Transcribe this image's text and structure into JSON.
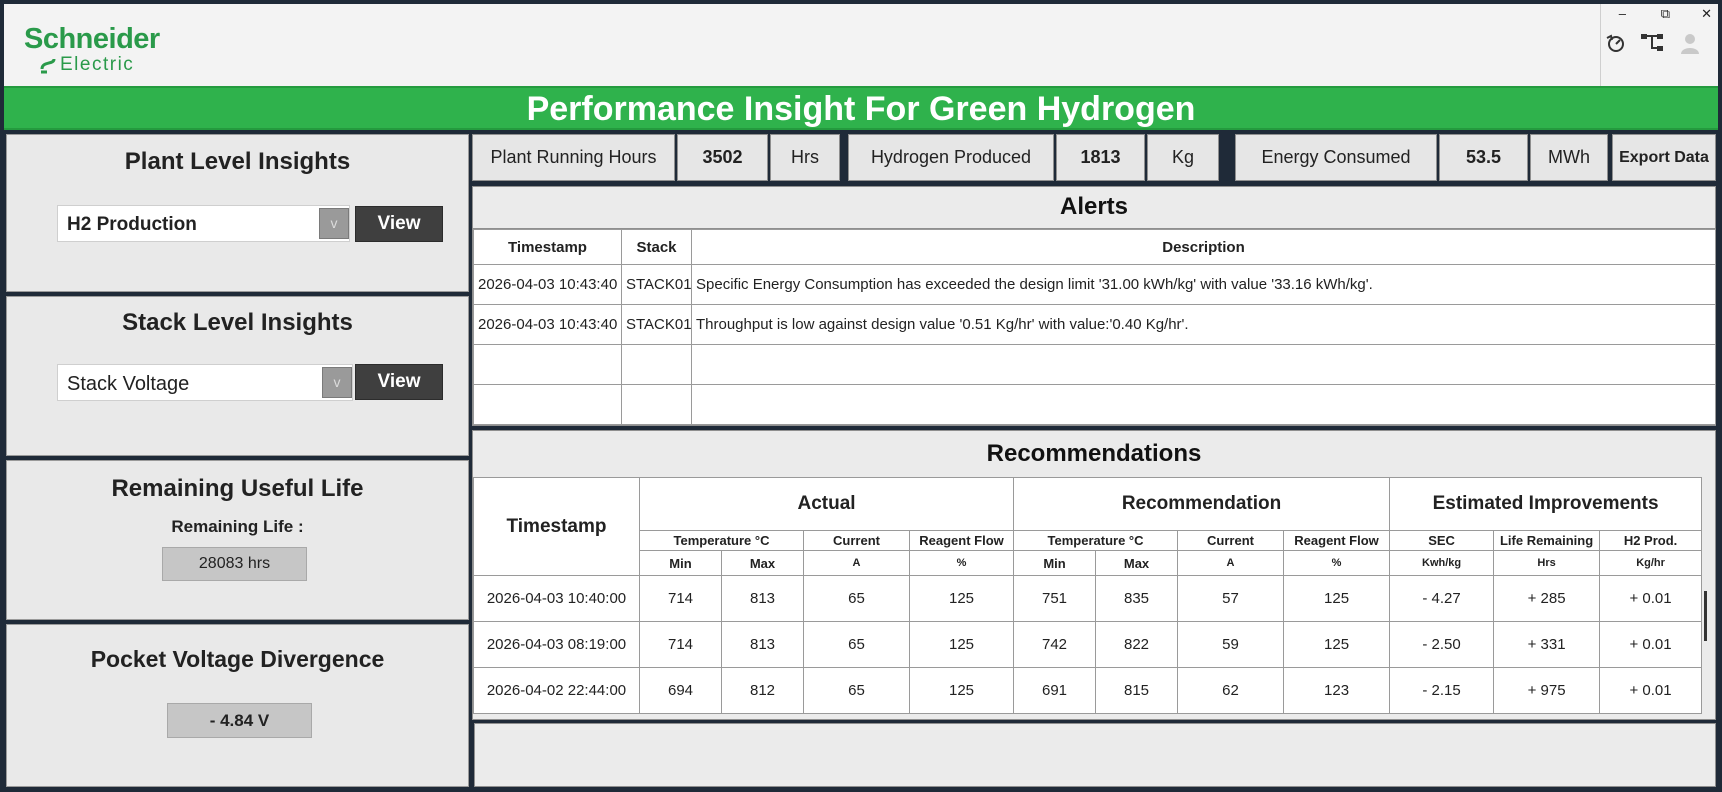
{
  "window": {
    "logo_line1": "Schneider",
    "logo_line2": "Electric",
    "controls": {
      "minimize": "–",
      "restore": "⧉",
      "close": "✕"
    },
    "icons": [
      "refresh-icon",
      "hierarchy-icon",
      "user-icon"
    ]
  },
  "banner": {
    "title": "Performance Insight For Green Hydrogen"
  },
  "plant": {
    "title": "Plant Level Insights",
    "selected": "H2 Production",
    "arrow": "v",
    "view_label": "View"
  },
  "stack": {
    "title": "Stack Level Insights",
    "selected": "Stack Voltage",
    "arrow": "v",
    "view_label": "View"
  },
  "rul": {
    "title": "Remaining Useful Life",
    "label": "Remaining Life :",
    "value": "28083 hrs"
  },
  "pvd": {
    "title": "Pocket Voltage Divergence",
    "value": "- 4.84 V"
  },
  "kpis": {
    "running_label": "Plant Running Hours",
    "running_value": "3502",
    "running_unit": "Hrs",
    "h2_label": "Hydrogen Produced",
    "h2_value": "1813",
    "h2_unit": "Kg",
    "energy_label": "Energy Consumed",
    "energy_value": "53.5",
    "energy_unit": "MWh",
    "export_label": "Export Data"
  },
  "alerts": {
    "title": "Alerts",
    "headers": [
      "Timestamp",
      "Stack",
      "Description"
    ],
    "rows": [
      [
        "2026-04-03 10:43:40",
        "STACK01",
        "Specific Energy Consumption has exceeded the design limit '31.00 kWh/kg' with value '33.16 kWh/kg'."
      ],
      [
        "2026-04-03 10:43:40",
        "STACK01",
        "Throughput is low against design value '0.51 Kg/hr' with value:'0.40 Kg/hr'."
      ],
      [
        "",
        "",
        ""
      ],
      [
        "",
        "",
        ""
      ]
    ]
  },
  "recs": {
    "title": "Recommendations",
    "timestamp_header": "Timestamp",
    "groups": [
      "Actual",
      "Recommendation",
      "Estimated Improvements"
    ],
    "sub": {
      "temperature": "Temperature °C",
      "current": "Current",
      "reagent": "Reagent Flow",
      "sec": "SEC",
      "life": "Life Remaining",
      "h2": "H2 Prod."
    },
    "units": {
      "min": "Min",
      "max": "Max",
      "amp": "A",
      "pct": "%",
      "sec": "Kwh/kg",
      "hrs": "Hrs",
      "kghr": "Kg/hr"
    },
    "rows": [
      [
        "2026-04-03 10:40:00",
        "714",
        "813",
        "65",
        "125",
        "751",
        "835",
        "57",
        "125",
        "- 4.27",
        "+ 285",
        "+ 0.01"
      ],
      [
        "2026-04-03 08:19:00",
        "714",
        "813",
        "65",
        "125",
        "742",
        "822",
        "59",
        "125",
        "- 2.50",
        "+ 331",
        "+ 0.01"
      ],
      [
        "2026-04-02 22:44:00",
        "694",
        "812",
        "65",
        "125",
        "691",
        "815",
        "62",
        "123",
        "- 2.15",
        "+ 975",
        "+ 0.01"
      ]
    ]
  }
}
